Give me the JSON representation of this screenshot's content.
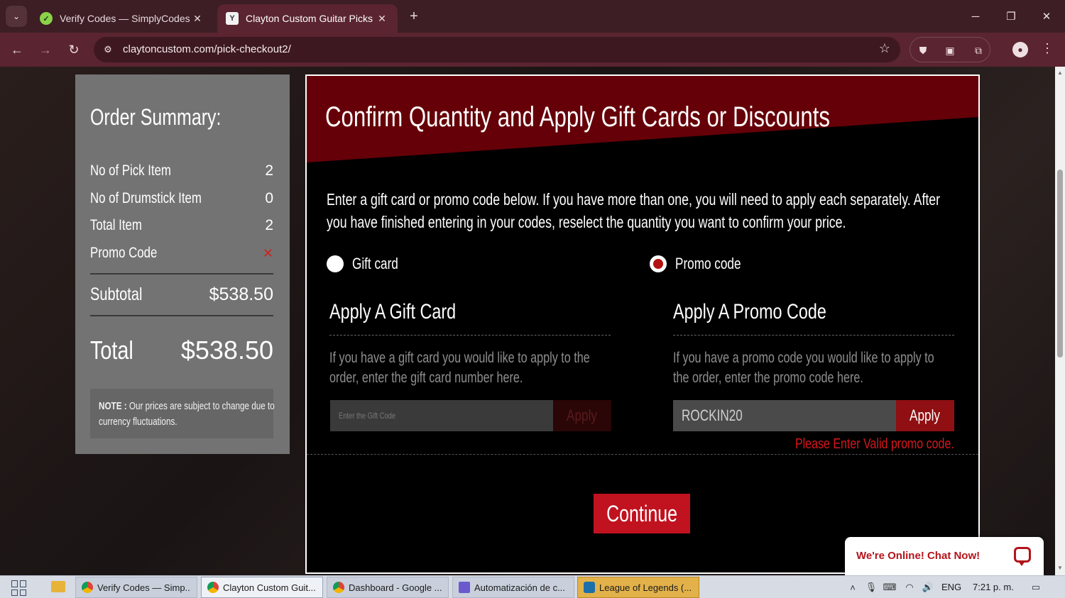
{
  "browser": {
    "tabs": [
      {
        "title": "Verify Codes — SimplyCodes",
        "active": false
      },
      {
        "title": "Clayton Custom Guitar Picks - P",
        "active": true
      }
    ],
    "url": "claytoncustom.com/pick-checkout2/"
  },
  "summary": {
    "title": "Order Summary:",
    "rows": [
      {
        "label": "No of Pick Item",
        "value": "2"
      },
      {
        "label": "No of Drumstick Item",
        "value": "0"
      },
      {
        "label": "Total Item",
        "value": "2"
      },
      {
        "label": "Promo Code",
        "value": "✕"
      }
    ],
    "subtotal_label": "Subtotal",
    "subtotal_value": "$538.50",
    "total_label": "Total",
    "total_value": "$538.50",
    "note_bold": "NOTE :",
    "note_text": "Our prices are subject to change due to currency fluctuations."
  },
  "panel": {
    "title": "Confirm Quantity and Apply Gift Cards or Discounts",
    "intro": "Enter a gift card or promo code below. If you have more than one, you will need to apply each separately. After you have finished entering in your codes, reselect the quantity you want to confirm your price.",
    "radio_gift": "Gift card",
    "radio_promo": "Promo code",
    "selected": "promo",
    "gift": {
      "title": "Apply A Gift Card",
      "desc": "If you have a gift card you would like to apply to the order, enter the gift card number here.",
      "placeholder": "Enter the Gift Code",
      "apply": "Apply"
    },
    "promo": {
      "title": "Apply A Promo Code",
      "desc": "If you have a promo code you would like to apply to the order, enter the promo code here.",
      "value": "ROCKIN20",
      "apply": "Apply",
      "error": "Please Enter Valid promo code."
    },
    "continue": "Continue"
  },
  "chat": {
    "label": "We're Online! Chat Now!"
  },
  "taskbar": {
    "items": [
      {
        "label": "Verify Codes — Simp..."
      },
      {
        "label": "Clayton Custom Guit..."
      },
      {
        "label": "Dashboard - Google ..."
      },
      {
        "label": "Automatización de c..."
      },
      {
        "label": "League of Legends (..."
      }
    ],
    "lang": "ENG",
    "time": "7:21 p. m."
  },
  "colors": {
    "accent": "#c1121f",
    "header_red": "#650008",
    "panel_bg": "#000000",
    "summary_bg": "#737373"
  }
}
